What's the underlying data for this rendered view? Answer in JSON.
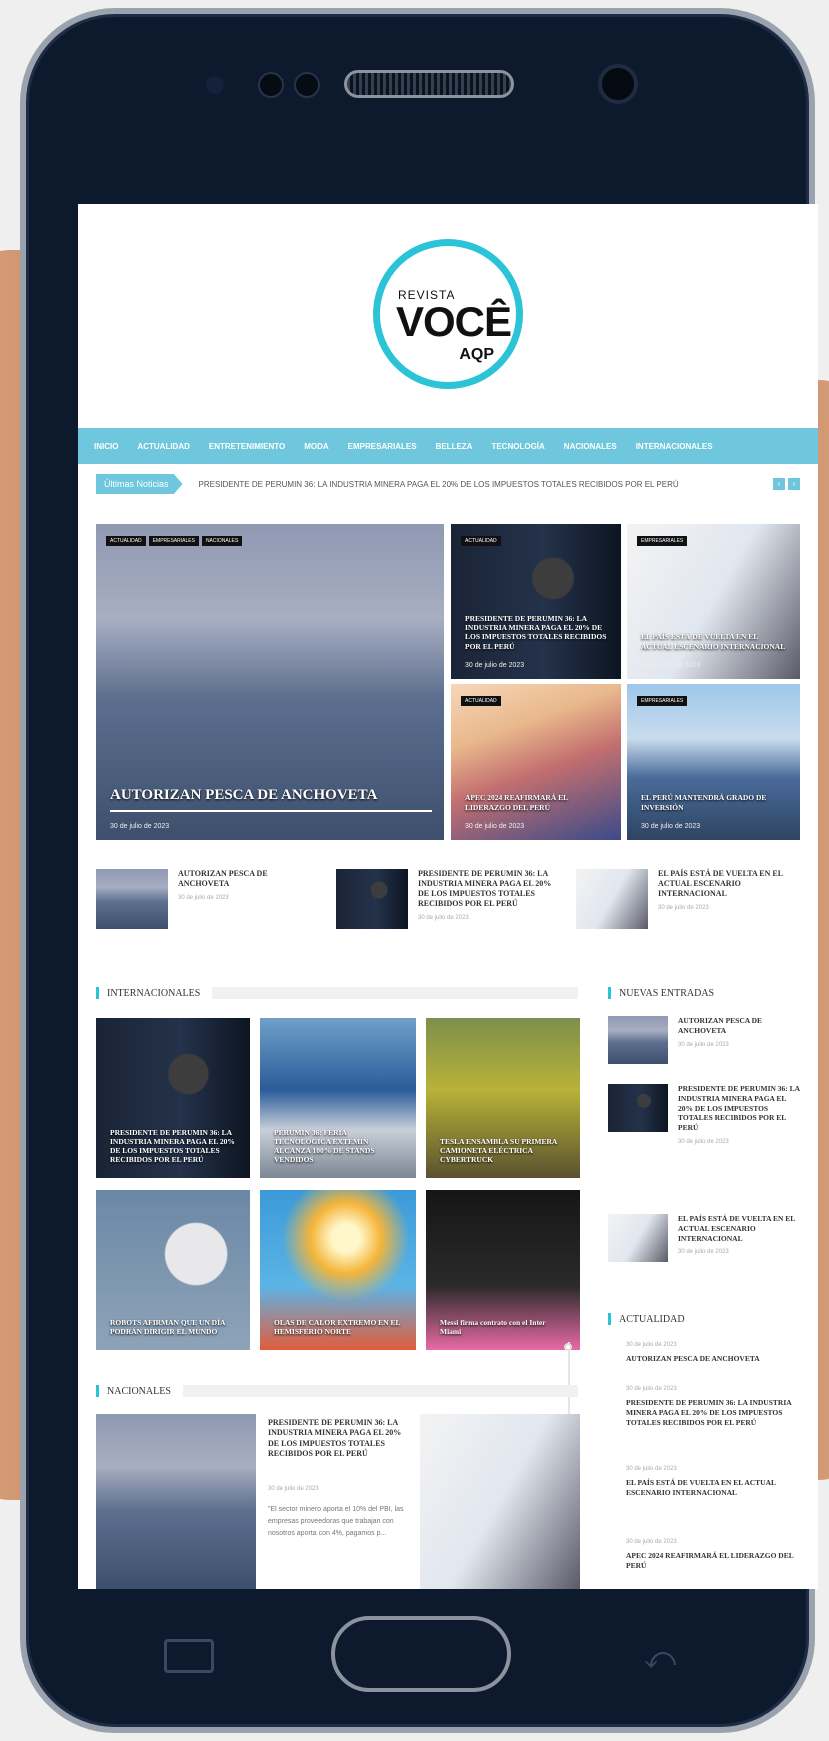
{
  "logo": {
    "top": "REVISTA",
    "main": "VOCÊ",
    "bottom": "AQP"
  },
  "menu": [
    "INICIO",
    "ACTUALIDAD",
    "ENTRETENIMIENTO",
    "MODA",
    "EMPRESARIALES",
    "BELLEZA",
    "TECNOLOGÍA",
    "NACIONALES",
    "INTERNACIONALES"
  ],
  "ticker": {
    "label": "Últimas Noticias",
    "text": "PRESIDENTE DE PERUMIN 36: LA INDUSTRIA MINERA PAGA EL 20% DE LOS IMPUESTOS TOTALES RECIBIDOS POR EL PERÚ",
    "prev": "‹",
    "next": "›"
  },
  "featured": {
    "main": {
      "tags": [
        "ACTUALIDAD",
        "EMPRESARIALES",
        "NACIONALES"
      ],
      "title": "AUTORIZAN PESCA DE ANCHOVETA",
      "date": "30 de julio de 2023"
    },
    "a": {
      "tag": "ACTUALIDAD",
      "title": "PRESIDENTE DE PERUMIN 36: LA INDUSTRIA MINERA PAGA EL 20% DE LOS IMPUESTOS TOTALES RECIBIDOS POR EL PERÚ",
      "date": "30 de julio de 2023"
    },
    "b": {
      "tag": "EMPRESARIALES",
      "title": "EL PAÍS ESTÁ DE VUELTA EN EL ACTUAL ESCENARIO INTERNACIONAL",
      "date": "30 de julio de 2023"
    },
    "c": {
      "tag": "ACTUALIDAD",
      "title": "APEC 2024 REAFIRMARÁ EL LIDERAZGO DEL PERÚ",
      "date": "30 de julio de 2023"
    },
    "d": {
      "tag": "EMPRESARIALES",
      "title": "EL PERÚ MANTENDRÁ GRADO DE INVERSIÓN",
      "date": "30 de julio de 2023"
    }
  },
  "recent": [
    {
      "title": "AUTORIZAN PESCA DE ANCHOVETA",
      "date": "30 de julio de 2023"
    },
    {
      "title": "PRESIDENTE DE PERUMIN 36: LA INDUSTRIA MINERA PAGA EL 20% DE LOS IMPUESTOS TOTALES RECIBIDOS POR EL PERÚ",
      "date": "30 de julio de 2023"
    },
    {
      "title": "EL PAÍS ESTÁ DE VUELTA EN EL ACTUAL ESCENARIO INTERNACIONAL",
      "date": "30 de julio de 2023"
    }
  ],
  "internacionales": {
    "heading": "INTERNACIONALES",
    "items": [
      "PRESIDENTE DE PERUMIN 36: LA INDUSTRIA MINERA PAGA EL 20% DE LOS IMPUESTOS TOTALES RECIBIDOS POR EL PERÚ",
      "PERUMIN 36: FERIA TECNOLÓGICA EXTEMIN ALCANZA 100% DE STANDS VENDIDOS",
      "TESLA ENSAMBLA SU PRIMERA CAMIONETA ELÉCTRICA CYBERTRUCK",
      "ROBOTS AFIRMAN QUE UN DÍA PODRÁN DIRIGIR EL MUNDO",
      "OLAS DE CALOR EXTREMO EN EL HEMISFERIO NORTE",
      "Messi firma contrato con el Inter Miami"
    ]
  },
  "nuevas": {
    "heading": "NUEVAS ENTRADAS",
    "items": [
      {
        "title": "AUTORIZAN PESCA DE ANCHOVETA",
        "date": "30 de julio de 2023"
      },
      {
        "title": "PRESIDENTE DE PERUMIN 36: LA INDUSTRIA MINERA PAGA EL 20% DE LOS IMPUESTOS TOTALES RECIBIDOS POR EL PERÚ",
        "date": "30 de julio de 2023"
      },
      {
        "title": "EL PAÍS ESTÁ DE VUELTA EN EL ACTUAL ESCENARIO INTERNACIONAL",
        "date": "30 de julio de 2023"
      }
    ]
  },
  "actualidad": {
    "heading": "ACTUALIDAD",
    "items": [
      {
        "date": "30 de julio de 2023",
        "title": "AUTORIZAN PESCA DE ANCHOVETA"
      },
      {
        "date": "30 de julio de 2023",
        "title": "PRESIDENTE DE PERUMIN 36: LA INDUSTRIA MINERA PAGA EL 20% DE LOS IMPUESTOS TOTALES RECIBIDOS POR EL PERÚ"
      },
      {
        "date": "30 de julio de 2023",
        "title": "EL PAÍS ESTÁ DE VUELTA EN EL ACTUAL ESCENARIO INTERNACIONAL"
      },
      {
        "date": "30 de julio de 2023",
        "title": "APEC 2024 REAFIRMARÁ EL LIDERAZGO DEL PERÚ"
      }
    ]
  },
  "nacionales": {
    "heading": "NACIONALES",
    "title": "PRESIDENTE DE PERUMIN 36: LA INDUSTRIA MINERA PAGA EL 20% DE LOS IMPUESTOS TOTALES RECIBIDOS POR EL PERÚ",
    "date": "30 de julio de 2023",
    "excerpt": "\"El sector minero aporta el 10% del PBI, las empresas proveedoras que trabajan con nosotros aporta con 4%, pagamos p..."
  }
}
